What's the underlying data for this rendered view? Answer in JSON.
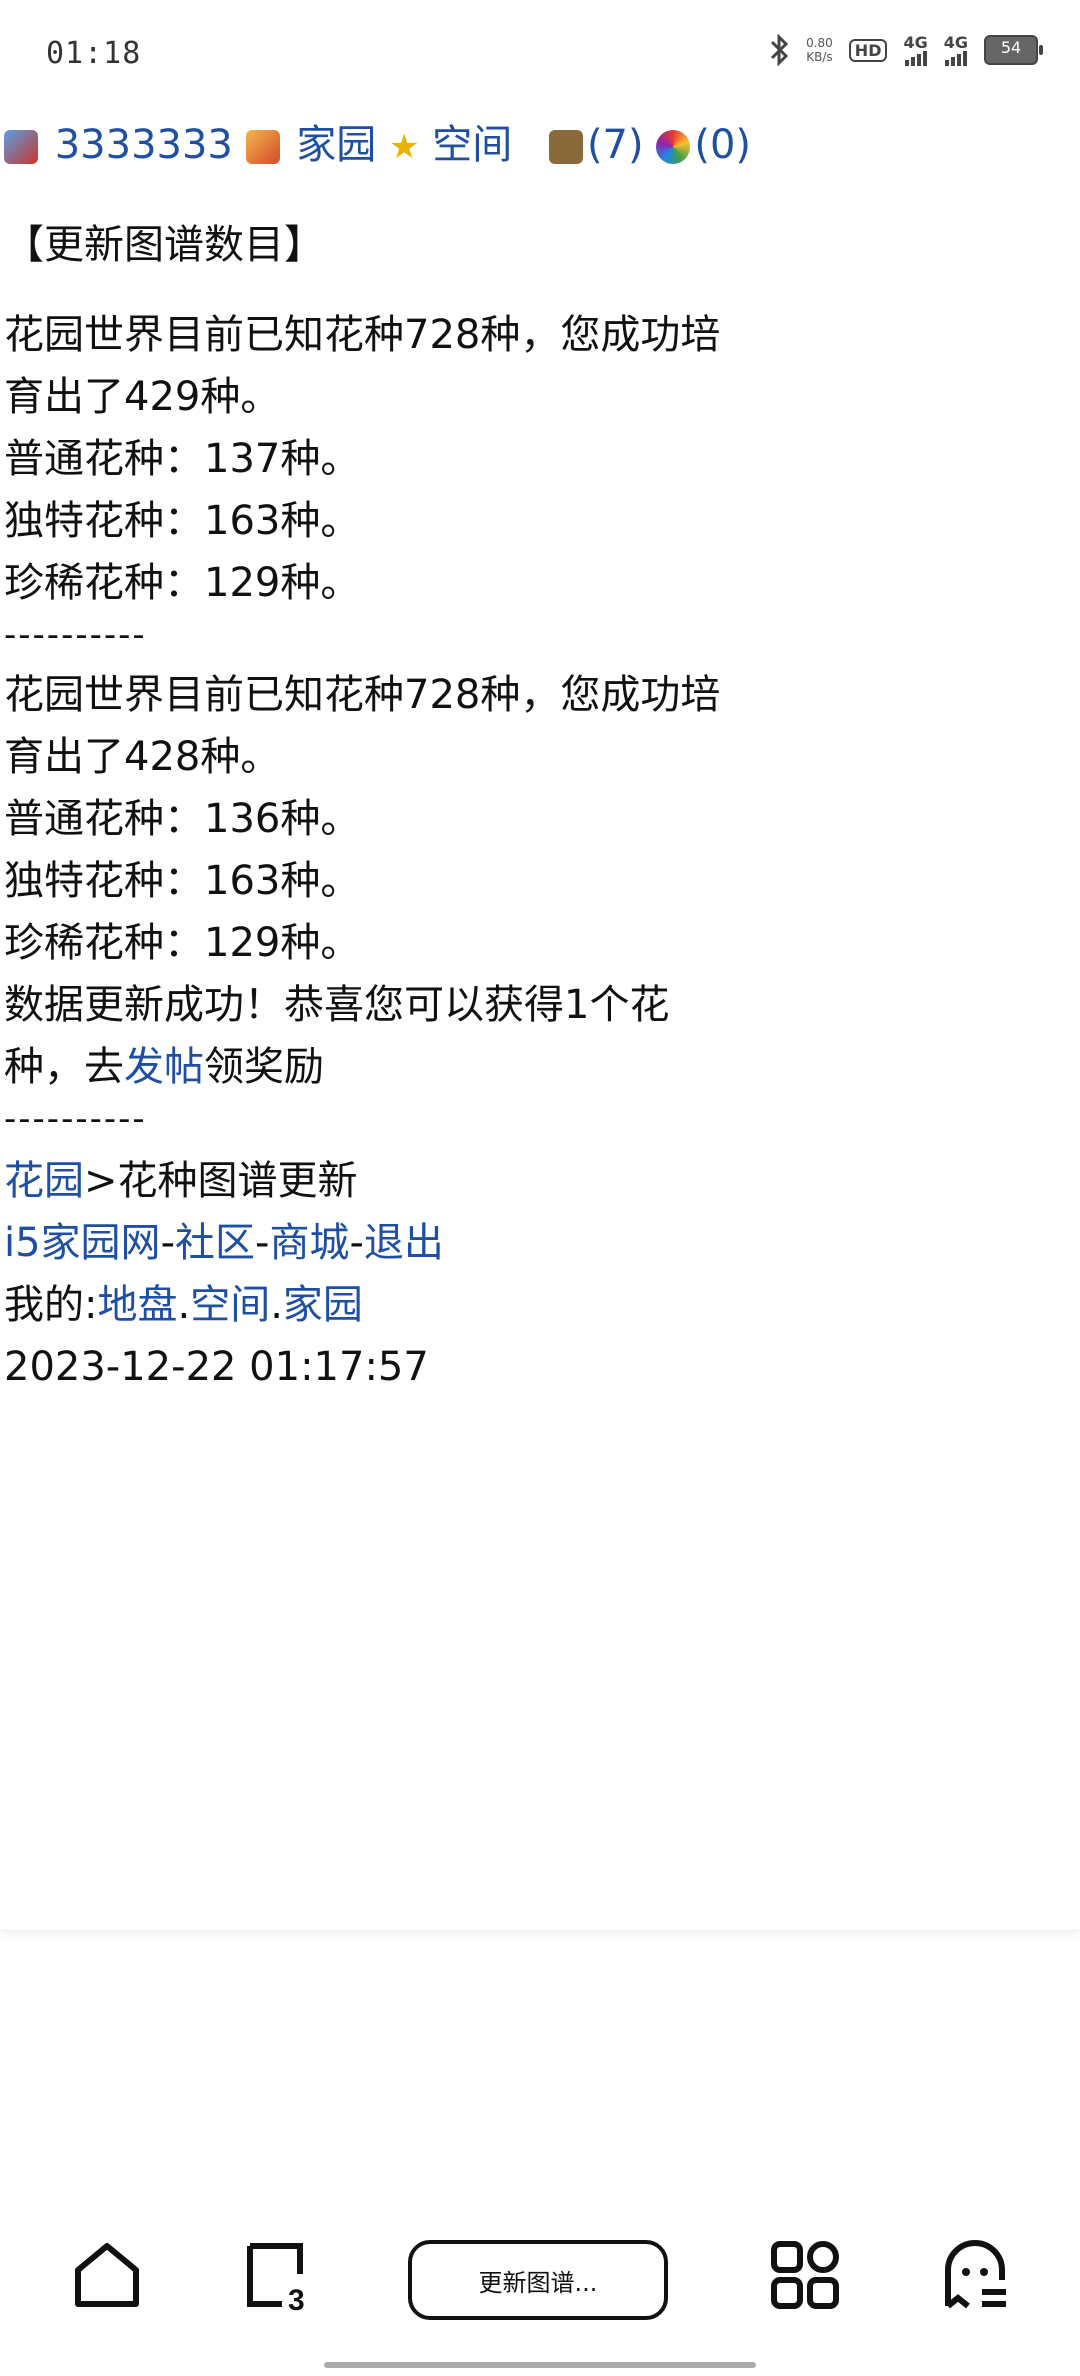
{
  "status_bar": {
    "time": "01:18",
    "speed": "0.80",
    "speed_unit": "KB/s",
    "hd_label": "HD",
    "net1": "4G",
    "net2": "4G",
    "battery": "54"
  },
  "header": {
    "user": "3333333",
    "links": [
      "家园",
      "空间"
    ],
    "messages": "(7)",
    "notices": "(0)"
  },
  "title": "【更新图谱数目】",
  "block1": {
    "summary_a": "花园世界目前已知花种728种，您成功培",
    "summary_b": "育出了429种。",
    "common": "普通花种：137种。",
    "unique": "独特花种：163种。",
    "rare": "珍稀花种：129种。"
  },
  "separator": "----------",
  "block2": {
    "summary_a": "花园世界目前已知花种728种，您成功培",
    "summary_b": "育出了428种。",
    "common": "普通花种：136种。",
    "unique": "独特花种：163种。",
    "rare": "珍稀花种：129种。"
  },
  "success": {
    "line_a": "数据更新成功！恭喜您可以获得1个花",
    "line_b_prefix": "种，去",
    "post_link": "发帖",
    "line_b_suffix": "领奖励"
  },
  "breadcrumb": {
    "garden": "花园",
    "current": ">花种图谱更新"
  },
  "footer_nav": {
    "i5": "i5",
    "home": "家园网",
    "community": "社区",
    "mall": "商城",
    "logout": "退出",
    "sep": "-"
  },
  "mine": {
    "label": "我的:",
    "land": "地盘",
    "space": "空间",
    "home": "家园",
    "dot": "."
  },
  "timestamp": "2023-12-22 01:17:57",
  "bottom_nav": {
    "address_text": "更新图谱...",
    "tabs_count": "3"
  }
}
